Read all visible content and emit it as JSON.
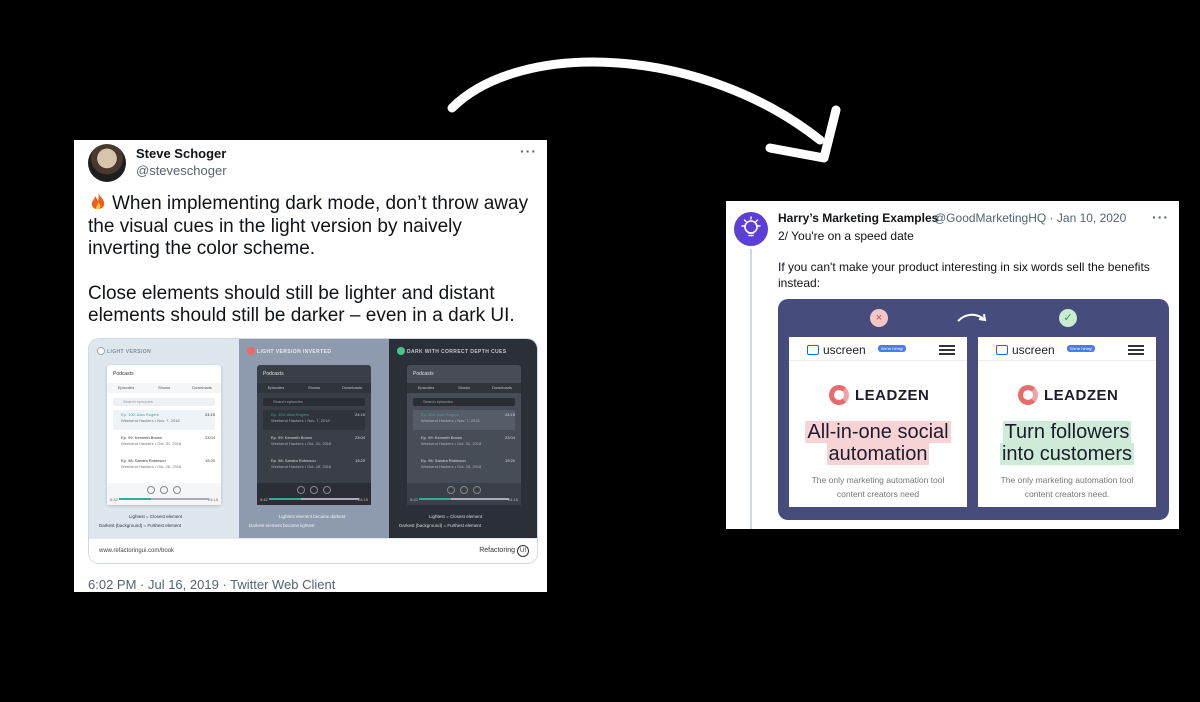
{
  "tweet1": {
    "name": "Steve Schoger",
    "handle": "@steveschoger",
    "paragraph1": "When implementing dark mode, don’t throw away the visual cues in the light version by naively inverting the color scheme.",
    "paragraph2": "Close elements should still be lighter and distant elements should still be darker – even in a dark UI.",
    "meta": "6:02 PM · Jul 16, 2019 · Twitter Web Client",
    "image": {
      "panels": [
        {
          "title": "LIGHT VERSION",
          "legend_a": "Lightest = Closest element",
          "legend_b": "Darkest (background) = Furthest element"
        },
        {
          "title": "LIGHT VERSION INVERTED",
          "legend_a": "Lightest element became darkest",
          "legend_b": "Darkest element became lightest"
        },
        {
          "title": "DARK WITH CORRECT DEPTH CUES",
          "legend_a": "Lightest = Closest element",
          "legend_b": "Darkest (background) = Furthest element"
        }
      ],
      "mock": {
        "title": "Podcasts",
        "tabs": [
          "Episodes",
          "Shows",
          "Downloads"
        ],
        "search_placeholder": "Search episodes",
        "rows": [
          {
            "title": "Ep. 100: Alan Rogers",
            "sub": "Weekend Hackers • Nov. 7, 2018",
            "dur": "24:15"
          },
          {
            "title": "Ep. 99: Kenneth Brown",
            "sub": "Weekend Hackers • Oct. 31, 2018",
            "dur": "23:04"
          },
          {
            "title": "Ep. 98: Sandra Robinson",
            "sub": "Weekend Hackers • Oct. 28, 2018",
            "dur": "19:20"
          }
        ],
        "time_start": "5:42",
        "time_end": "24:15"
      },
      "footer_url": "www.refactoringui.com/book",
      "footer_brand": "Refactoring",
      "footer_brand_mark": "UI"
    }
  },
  "tweet2": {
    "name": "Harry’s Marketing Examples",
    "handle_date": "@GoodMarketingHQ · Jan 10, 2020",
    "line1": "2/ You're on a speed date",
    "line2": "If you can't make your product interesting in six words sell the benefits instead:",
    "card": {
      "ads": [
        {
          "logo": "uscreen",
          "hiring": "We're hiring!",
          "brand": "LEADZEN",
          "headline1": "All-in-one social",
          "headline2": "automation",
          "sub1": "The only marketing automation tool",
          "sub2": "content creators need"
        },
        {
          "logo": "uscreen",
          "hiring": "We're hiring!",
          "brand": "LEADZEN",
          "headline1": "Turn followers",
          "headline2": "into customers",
          "sub1": "The only marketing automation tool",
          "sub2": "content creators need."
        }
      ],
      "bad_mark": "×",
      "good_mark": "✓"
    }
  },
  "colors": {
    "card2_bg": "#464d7c",
    "accent_teal": "#3aa898",
    "bad": "#c84a4a",
    "good": "#2f9a58"
  }
}
